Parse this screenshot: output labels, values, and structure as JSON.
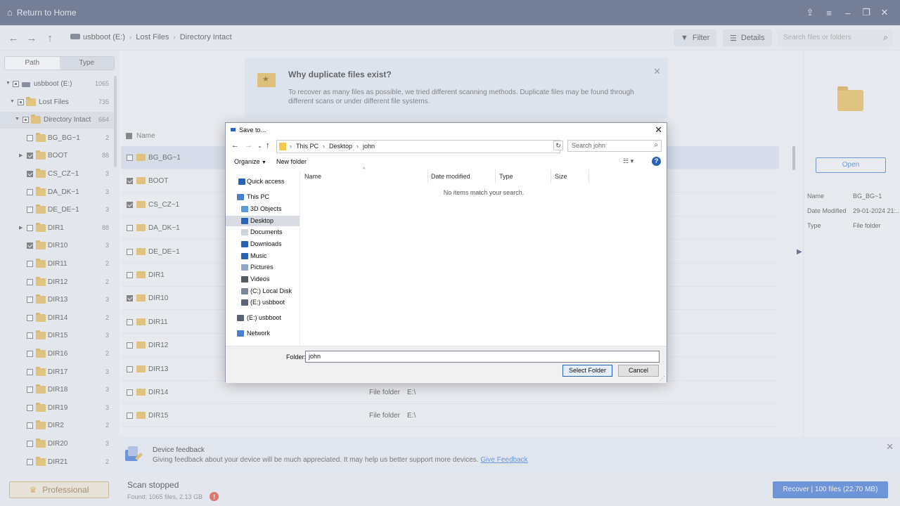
{
  "titlebar": {
    "return_home": "Return to Home"
  },
  "nav": {
    "breadcrumbs": [
      "usbboot (E:)",
      "Lost Files",
      "Directory Intact"
    ],
    "filter_label": "Filter",
    "details_label": "Details",
    "search_placeholder": "Search files or folders"
  },
  "left": {
    "tabs": [
      "Path",
      "Type"
    ],
    "tree": [
      {
        "label": "usbboot (E:)",
        "count": "1065"
      },
      {
        "label": "Lost Files",
        "count": "735"
      },
      {
        "label": "Directory Intact",
        "count": "664"
      },
      {
        "label": "BG_BG~1",
        "count": "2"
      },
      {
        "label": "BOOT",
        "count": "88"
      },
      {
        "label": "CS_CZ~1",
        "count": "3"
      },
      {
        "label": "DA_DK~1",
        "count": "3"
      },
      {
        "label": "DE_DE~1",
        "count": "3"
      },
      {
        "label": "DIR1",
        "count": "88"
      },
      {
        "label": "DIR10",
        "count": "3"
      },
      {
        "label": "DIR11",
        "count": "2"
      },
      {
        "label": "DIR12",
        "count": "2"
      },
      {
        "label": "DIR13",
        "count": "3"
      },
      {
        "label": "DIR14",
        "count": "2"
      },
      {
        "label": "DIR15",
        "count": "3"
      },
      {
        "label": "DIR16",
        "count": "2"
      },
      {
        "label": "DIR17",
        "count": "3"
      },
      {
        "label": "DIR18",
        "count": "3"
      },
      {
        "label": "DIR19",
        "count": "3"
      },
      {
        "label": "DIR2",
        "count": "2"
      },
      {
        "label": "DIR20",
        "count": "3"
      },
      {
        "label": "DIR21",
        "count": "2"
      }
    ]
  },
  "banner": {
    "title": "Why duplicate files exist?",
    "text": "To recover as many files as possible, we tried different scanning methods. Duplicate files may be found through different scans or under different file systems."
  },
  "files": {
    "name_header": "Name",
    "rows": [
      {
        "name": "BG_BG~1",
        "type": "",
        "path": ""
      },
      {
        "name": "BOOT",
        "type": "",
        "path": ""
      },
      {
        "name": "CS_CZ~1",
        "type": "",
        "path": ""
      },
      {
        "name": "DA_DK~1",
        "type": "",
        "path": ""
      },
      {
        "name": "DE_DE~1",
        "type": "",
        "path": ""
      },
      {
        "name": "DIR1",
        "type": "",
        "path": ""
      },
      {
        "name": "DIR10",
        "type": "",
        "path": ""
      },
      {
        "name": "DIR11",
        "type": "",
        "path": ""
      },
      {
        "name": "DIR12",
        "type": "",
        "path": ""
      },
      {
        "name": "DIR13",
        "type": "",
        "path": ""
      },
      {
        "name": "DIR14",
        "type": "File folder",
        "path": "E:\\"
      },
      {
        "name": "DIR15",
        "type": "File folder",
        "path": "E:\\"
      }
    ]
  },
  "details": {
    "open_label": "Open",
    "props": [
      {
        "k": "Name",
        "v": "BG_BG~1"
      },
      {
        "k": "Date Modified",
        "v": "29-01-2024 21:.."
      },
      {
        "k": "Type",
        "v": "File folder"
      }
    ]
  },
  "feedback": {
    "title": "Device feedback",
    "text": "Giving feedback about your device will be much appreciated. It may help us better support more devices.",
    "link": "Give Feedback"
  },
  "footer": {
    "pro_label": "Professional",
    "scan_status": "Scan stopped",
    "found": "Found: 1065 files, 2.13 GB",
    "recover_label": "Recover | 100 files (22.70 MB)"
  },
  "dialog": {
    "title": "Save to...",
    "path": [
      "This PC",
      "Desktop",
      "john"
    ],
    "search_placeholder": "Search john",
    "organize": "Organize",
    "new_folder": "New folder",
    "nav": [
      {
        "label": "Quick access"
      },
      {
        "label": "This PC"
      },
      {
        "label": "3D Objects"
      },
      {
        "label": "Desktop"
      },
      {
        "label": "Documents"
      },
      {
        "label": "Downloads"
      },
      {
        "label": "Music"
      },
      {
        "label": "Pictures"
      },
      {
        "label": "Videos"
      },
      {
        "label": "(C:) Local Disk"
      },
      {
        "label": "(E:) usbboot"
      },
      {
        "label": "(E:) usbboot"
      },
      {
        "label": "Network"
      }
    ],
    "columns": [
      "Name",
      "Date modified",
      "Type",
      "Size"
    ],
    "empty_text": "No items match your search.",
    "folder_label": "Folder:",
    "folder_value": "john",
    "select_label": "Select Folder",
    "cancel_label": "Cancel"
  }
}
